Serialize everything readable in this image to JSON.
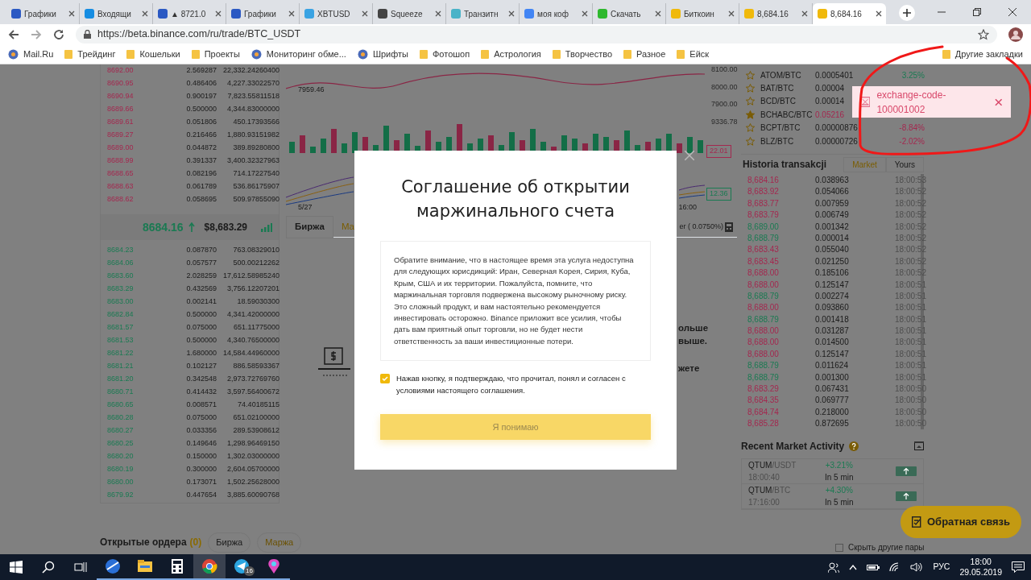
{
  "browser": {
    "tabs": [
      {
        "title": "Графики",
        "selected": false
      },
      {
        "title": "Входящи",
        "selected": false
      },
      {
        "title": "▲ 8721.0",
        "selected": false
      },
      {
        "title": "Графики",
        "selected": false
      },
      {
        "title": "XBTUSD",
        "selected": false
      },
      {
        "title": "Squeeze",
        "selected": false
      },
      {
        "title": "Транзитн",
        "selected": false
      },
      {
        "title": "моя коф",
        "selected": false
      },
      {
        "title": "Скачать",
        "selected": false
      },
      {
        "title": "Биткоин",
        "selected": false
      },
      {
        "title": "8,684.16",
        "selected": false
      },
      {
        "title": "8,684.16",
        "selected": true
      }
    ],
    "url": "https://beta.binance.com/ru/trade/BTC_USDT",
    "bookmarks": [
      {
        "label": "Mail.Ru",
        "kind": "site"
      },
      {
        "label": "Трейдинг",
        "kind": "folder"
      },
      {
        "label": "Кошельки",
        "kind": "folder"
      },
      {
        "label": "Проекты",
        "kind": "folder"
      },
      {
        "label": "Мониторинг обме...",
        "kind": "site"
      },
      {
        "label": "Шрифты",
        "kind": "site"
      },
      {
        "label": "Фотошоп",
        "kind": "folder"
      },
      {
        "label": "Астрология",
        "kind": "folder"
      },
      {
        "label": "Творчество",
        "kind": "folder"
      },
      {
        "label": "Разное",
        "kind": "folder"
      },
      {
        "label": "Ейск",
        "kind": "folder"
      }
    ],
    "other_bookmarks": "Другие закладки"
  },
  "order_book": {
    "asks": [
      {
        "price": "8692.00",
        "amount": "2.569287",
        "total": "22,332.24260400"
      },
      {
        "price": "8690.95",
        "amount": "0.486406",
        "total": "4,227.33022570"
      },
      {
        "price": "8690.94",
        "amount": "0.900197",
        "total": "7,823.55811518"
      },
      {
        "price": "8689.66",
        "amount": "0.500000",
        "total": "4,344.83000000"
      },
      {
        "price": "8689.61",
        "amount": "0.051806",
        "total": "450.17393566"
      },
      {
        "price": "8689.27",
        "amount": "0.216466",
        "total": "1,880.93151982"
      },
      {
        "price": "8689.00",
        "amount": "0.044872",
        "total": "389.89280800"
      },
      {
        "price": "8688.99",
        "amount": "0.391337",
        "total": "3,400.32327963"
      },
      {
        "price": "8688.65",
        "amount": "0.082196",
        "total": "714.17227540"
      },
      {
        "price": "8688.63",
        "amount": "0.061789",
        "total": "536.86175907"
      },
      {
        "price": "8688.62",
        "amount": "0.058695",
        "total": "509.97855090"
      }
    ],
    "last_price": "8684.16",
    "usd_price": "$8,683.29",
    "bids": [
      {
        "price": "8684.23",
        "amount": "0.087870",
        "total": "763.08329010"
      },
      {
        "price": "8684.06",
        "amount": "0.057577",
        "total": "500.00212262"
      },
      {
        "price": "8683.60",
        "amount": "2.028259",
        "total": "17,612.58985240"
      },
      {
        "price": "8683.29",
        "amount": "0.432569",
        "total": "3,756.12207201"
      },
      {
        "price": "8683.00",
        "amount": "0.002141",
        "total": "18.59030300"
      },
      {
        "price": "8682.84",
        "amount": "0.500000",
        "total": "4,341.42000000"
      },
      {
        "price": "8681.57",
        "amount": "0.075000",
        "total": "651.11775000"
      },
      {
        "price": "8681.53",
        "amount": "0.500000",
        "total": "4,340.76500000"
      },
      {
        "price": "8681.22",
        "amount": "1.680000",
        "total": "14,584.44960000"
      },
      {
        "price": "8681.21",
        "amount": "0.102127",
        "total": "886.58593367"
      },
      {
        "price": "8681.20",
        "amount": "0.342548",
        "total": "2,973.72769760"
      },
      {
        "price": "8680.71",
        "amount": "0.414432",
        "total": "3,597.56400672"
      },
      {
        "price": "8680.65",
        "amount": "0.008571",
        "total": "74.40185115"
      },
      {
        "price": "8680.28",
        "amount": "0.075000",
        "total": "651.02100000"
      },
      {
        "price": "8680.27",
        "amount": "0.033356",
        "total": "289.53908612"
      },
      {
        "price": "8680.25",
        "amount": "0.149646",
        "total": "1,298.96469150"
      },
      {
        "price": "8680.20",
        "amount": "0.150000",
        "total": "1,302.03000000"
      },
      {
        "price": "8680.19",
        "amount": "0.300000",
        "total": "2,604.05700000"
      },
      {
        "price": "8680.00",
        "amount": "0.173071",
        "total": "1,502.25628000"
      },
      {
        "price": "8679.92",
        "amount": "0.447654",
        "total": "3,885.60090768"
      }
    ]
  },
  "chart": {
    "price_labels": [
      "8100.00",
      "8000.00",
      "7900.00",
      "9336.78"
    ],
    "low_label": "7959.46",
    "badges": [
      {
        "text": "22.01",
        "color": "#a3284f"
      },
      {
        "text": "12.36",
        "color": "#1a7a52"
      }
    ],
    "time_labels": [
      "5/27",
      "16:00"
    ],
    "tabs": [
      {
        "label": "Биржа",
        "selected": false
      },
      {
        "label": "Ма",
        "selected": true
      }
    ],
    "fee_text": "er ( 0.0750%)",
    "fragments": [
      "ольше",
      "выше.",
      "жете"
    ]
  },
  "markets": [
    {
      "pair": "ATOM/BTC",
      "price": "0.0005401",
      "change": "3.25%",
      "color": "#1a7a52",
      "starred": false
    },
    {
      "pair": "BAT/BTC",
      "price": "0.00004",
      "starred": false
    },
    {
      "pair": "BCD/BTC",
      "price": "0.00014",
      "starred": false
    },
    {
      "pair": "BCHABC/BTC",
      "price": "0.05216",
      "starred": true
    },
    {
      "pair": "BCPT/BTC",
      "price": "0.00000876",
      "change": "-8.84%",
      "color": "#a3284f",
      "starred": false
    },
    {
      "pair": "BLZ/BTC",
      "price": "0.00000726",
      "change": "-2.02%",
      "color": "#a3284f",
      "starred": false
    }
  ],
  "trade_history": {
    "title": "Historia transakcji",
    "toggle": [
      {
        "label": "Market",
        "selected": true
      },
      {
        "label": "Yours",
        "selected": false
      }
    ],
    "rows": [
      {
        "price": "8,684.16",
        "amount": "0.038963",
        "time": "18:00:53",
        "color": "#a3284f"
      },
      {
        "price": "8,683.92",
        "amount": "0.054066",
        "time": "18:00:52",
        "color": "#a3284f"
      },
      {
        "price": "8,683.77",
        "amount": "0.007959",
        "time": "18:00:52",
        "color": "#a3284f"
      },
      {
        "price": "8,683.79",
        "amount": "0.006749",
        "time": "18:00:52",
        "color": "#a3284f"
      },
      {
        "price": "8,689.00",
        "amount": "0.001342",
        "time": "18:00:52",
        "color": "#1a7a52"
      },
      {
        "price": "8,688.79",
        "amount": "0.000014",
        "time": "18:00:52",
        "color": "#1a7a52"
      },
      {
        "price": "8,683.43",
        "amount": "0.055040",
        "time": "18:00:52",
        "color": "#a3284f"
      },
      {
        "price": "8,683.45",
        "amount": "0.021250",
        "time": "18:00:52",
        "color": "#a3284f"
      },
      {
        "price": "8,688.00",
        "amount": "0.185106",
        "time": "18:00:52",
        "color": "#a3284f"
      },
      {
        "price": "8,688.00",
        "amount": "0.125147",
        "time": "18:00:51",
        "color": "#a3284f"
      },
      {
        "price": "8,688.79",
        "amount": "0.002274",
        "time": "18:00:51",
        "color": "#1a7a52"
      },
      {
        "price": "8,688.00",
        "amount": "0.093860",
        "time": "18:00:51",
        "color": "#a3284f"
      },
      {
        "price": "8,688.79",
        "amount": "0.001418",
        "time": "18:00:51",
        "color": "#1a7a52"
      },
      {
        "price": "8,688.00",
        "amount": "0.031287",
        "time": "18:00:51",
        "color": "#a3284f"
      },
      {
        "price": "8,688.00",
        "amount": "0.014500",
        "time": "18:00:51",
        "color": "#a3284f"
      },
      {
        "price": "8,688.00",
        "amount": "0.125147",
        "time": "18:00:51",
        "color": "#a3284f"
      },
      {
        "price": "8,688.79",
        "amount": "0.011624",
        "time": "18:00:51",
        "color": "#1a7a52"
      },
      {
        "price": "8,688.79",
        "amount": "0.001300",
        "time": "18:00:51",
        "color": "#1a7a52"
      },
      {
        "price": "8,683.29",
        "amount": "0.067431",
        "time": "18:00:50",
        "color": "#a3284f"
      },
      {
        "price": "8,684.35",
        "amount": "0.069777",
        "time": "18:00:50",
        "color": "#a3284f"
      },
      {
        "price": "8,684.74",
        "amount": "0.218000",
        "time": "18:00:50",
        "color": "#a3284f"
      },
      {
        "price": "8,685.28",
        "amount": "0.872695",
        "time": "18:00:50",
        "color": "#a3284f"
      }
    ]
  },
  "recent_activity": {
    "title": "Recent Market Activity",
    "rows": [
      {
        "base": "QTUM",
        "quote": "/USDT",
        "time": "18:00:40",
        "change": "+3.21%",
        "period": "In 5 min"
      },
      {
        "base": "QTUM",
        "quote": "/BTC",
        "time": "17:16:00",
        "change": "+4.30%",
        "period": "In 5 min"
      }
    ]
  },
  "open_orders": {
    "title": "Открытые ордера",
    "count": "(0)",
    "tabs": [
      {
        "label": "Биржа",
        "selected": false
      },
      {
        "label": "Маржа",
        "selected": true
      }
    ]
  },
  "feedback_button": "Обратная связь",
  "hide_pairs": {
    "label": "Скрыть другие пары",
    "checked": false
  },
  "toast": {
    "message": "exchange-code-100001002"
  },
  "modal": {
    "title": "Соглашение об открытии маржинального счета",
    "body": "Обратите внимание, что в настоящее время эта услуга недоступна для следующих юрисдикций: Иран, Северная Корея, Сирия, Куба, Крым, США и их территории. Пожалуйста, помните, что маржинальная торговля подвержена высокому рыночному риску. Это сложный продукт, и вам настоятельно рекомендуется инвестировать осторожно. Binance приложит все усилия, чтобы дать вам приятный опыт торговли, но не будет нести ответственность за ваши инвестиционные потери.",
    "agree": {
      "label": "Нажав кнопку, я подтверждаю, что прочитал, понял и согласен с условиями настоящего соглашения.",
      "checked": true
    },
    "button": "Я понимаю"
  },
  "taskbar": {
    "apps": [
      {
        "kind": "globe",
        "active": false
      },
      {
        "kind": "folder",
        "active": false
      },
      {
        "kind": "calculator",
        "active": false
      },
      {
        "kind": "chrome",
        "active": true
      },
      {
        "kind": "telegram",
        "active": false,
        "badge": "16"
      },
      {
        "kind": "paint",
        "active": false
      }
    ],
    "language": "РУС",
    "time": "18:00",
    "date": "29.05.2019"
  }
}
